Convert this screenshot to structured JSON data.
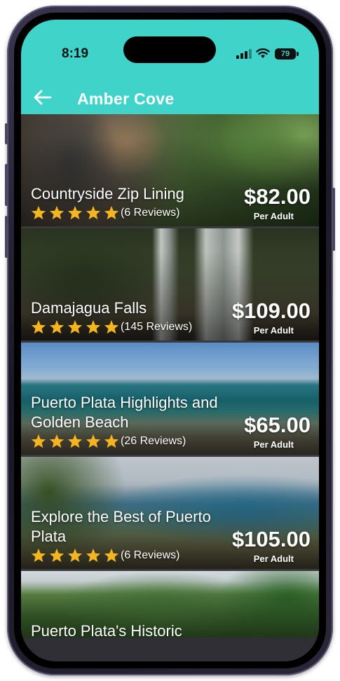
{
  "status_bar": {
    "time": "8:19",
    "battery": "79"
  },
  "header": {
    "title": "Amber Cove"
  },
  "tours": [
    {
      "name": "Countryside Zip Lining",
      "reviews": "(6 Reviews)",
      "price": "$82.00",
      "per": "Per Adult",
      "stars": 5
    },
    {
      "name": "Damajagua Falls",
      "reviews": "(145 Reviews)",
      "price": "$109.00",
      "per": "Per Adult",
      "stars": 5
    },
    {
      "name": "Puerto Plata Highlights and Golden Beach",
      "reviews": "(26 Reviews)",
      "price": "$65.00",
      "per": "Per Adult",
      "stars": 5
    },
    {
      "name": "Explore the Best of Puerto Plata",
      "reviews": "(6 Reviews)",
      "price": "$105.00",
      "per": "Per Adult",
      "stars": 5
    },
    {
      "name": "Puerto Plata's Historic"
    }
  ],
  "colors": {
    "header": "#3fd3c9",
    "star": "#f5b521"
  }
}
